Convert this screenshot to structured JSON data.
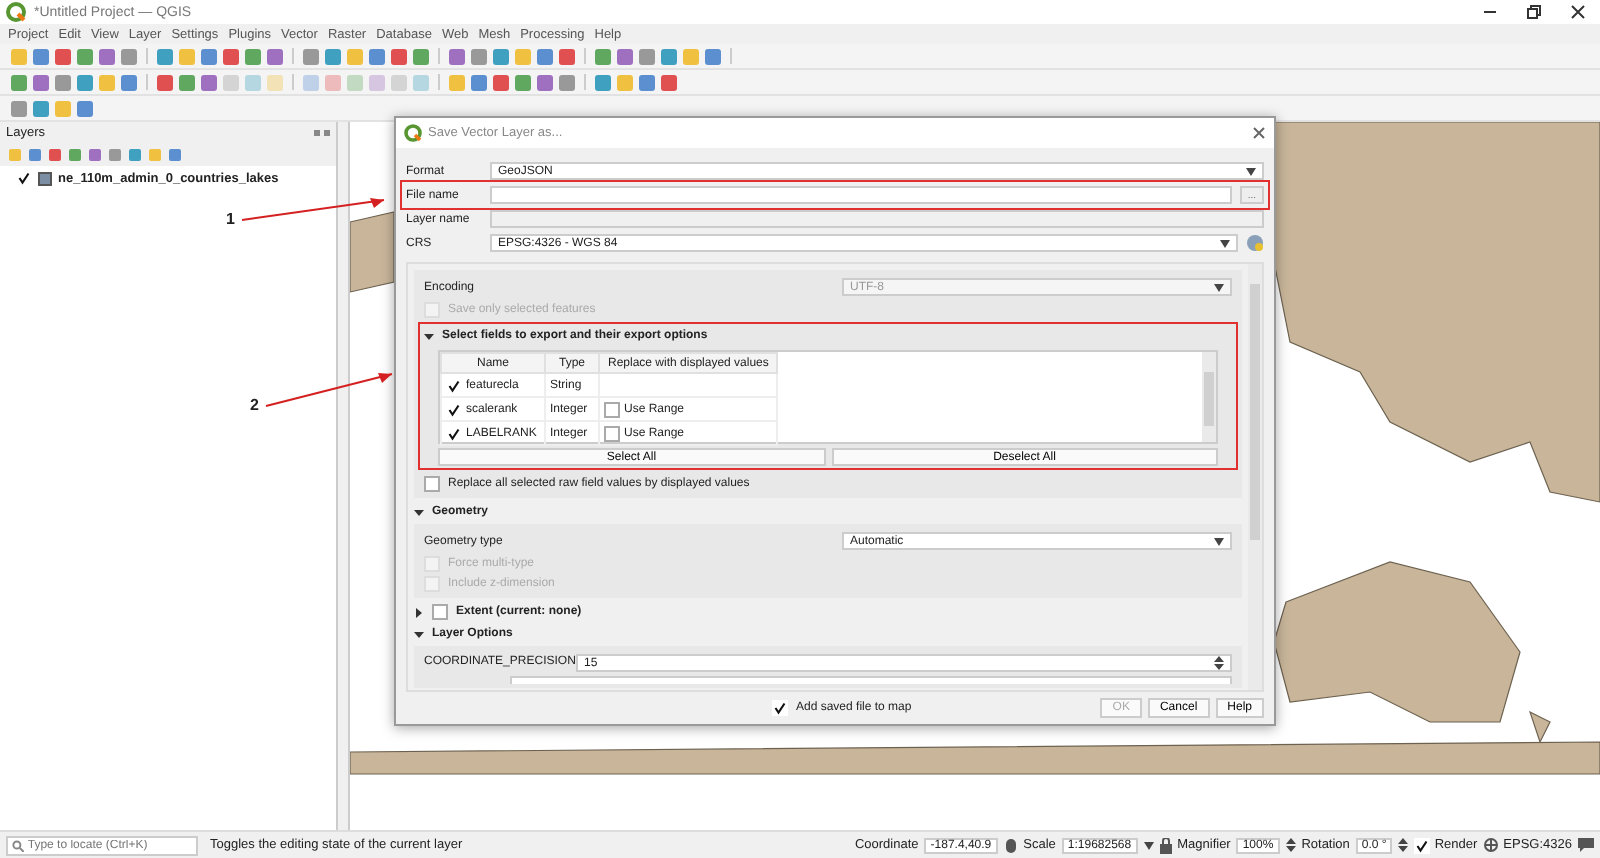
{
  "window": {
    "title": "*Untitled Project — QGIS"
  },
  "menu": [
    "Project",
    "Edit",
    "View",
    "Layer",
    "Settings",
    "Plugins",
    "Vector",
    "Raster",
    "Database",
    "Web",
    "Mesh",
    "Processing",
    "Help"
  ],
  "layers_panel": {
    "title": "Layers",
    "layers": [
      {
        "name": "ne_110m_admin_0_countries_lakes",
        "checked": true
      }
    ]
  },
  "dialog": {
    "title": "Save Vector Layer as...",
    "format": {
      "label": "Format",
      "value": "GeoJSON"
    },
    "file_name": {
      "label": "File name",
      "browse": "..."
    },
    "layer_name": {
      "label": "Layer name"
    },
    "crs": {
      "label": "CRS",
      "value": "EPSG:4326 - WGS 84"
    },
    "encoding": {
      "label": "Encoding",
      "value": "UTF-8",
      "disabled": true
    },
    "save_only_selected": {
      "label": "Save only selected features",
      "checked": false,
      "disabled": true
    },
    "fields": {
      "title": "Select fields to export and their export options",
      "expanded": true,
      "columns": [
        "Name",
        "Type",
        "Replace with displayed values"
      ],
      "rows": [
        {
          "name": "featurecla",
          "checked": true,
          "type": "String"
        },
        {
          "name": "scalerank",
          "checked": true,
          "type": "Integer",
          "replace": {
            "label": "Use Range",
            "checked": false
          }
        },
        {
          "name": "LABELRANK",
          "checked": true,
          "type": "Integer",
          "replace": {
            "label": "Use Range",
            "checked": false
          }
        }
      ],
      "buttons": [
        "Select All",
        "Deselect All"
      ]
    },
    "replace_all": {
      "label": "Replace all selected raw field values by displayed values",
      "checked": false
    },
    "geometry": {
      "title": "Geometry",
      "expanded": true,
      "type_label": "Geometry type",
      "type_value": "Automatic",
      "options": [
        {
          "label": "Force multi-type",
          "checked": false,
          "disabled": true
        },
        {
          "label": "Include z-dimension",
          "checked": false,
          "disabled": true
        }
      ]
    },
    "extent": {
      "title": "Extent (current: none)",
      "expanded": false,
      "checked": false
    },
    "layer_options": {
      "title": "Layer Options",
      "expanded": true,
      "options": [
        {
          "label": "COORDINATE_PRECISION",
          "value": "15"
        }
      ]
    },
    "add_to_map": {
      "label": "Add saved file to map",
      "checked": true
    },
    "buttons": [
      {
        "label": "OK",
        "disabled": true
      },
      {
        "label": "Cancel",
        "disabled": false
      },
      {
        "label": "Help",
        "disabled": false
      }
    ]
  },
  "annotations": [
    {
      "label": "1"
    },
    {
      "label": "2"
    }
  ],
  "status_bar": {
    "locator_placeholder": "Type to locate (Ctrl+K)",
    "message": "Toggles the editing state of the current layer",
    "coordinate_label": "Coordinate",
    "coordinate": "-187.4,40.9",
    "scale_label": "Scale",
    "scale": "1:19682568",
    "magnifier_label": "Magnifier",
    "magnifier": "100%",
    "rotation_label": "Rotation",
    "rotation": "0.0 °",
    "render": {
      "label": "Render",
      "checked": true
    },
    "crs": "EPSG:4326"
  }
}
